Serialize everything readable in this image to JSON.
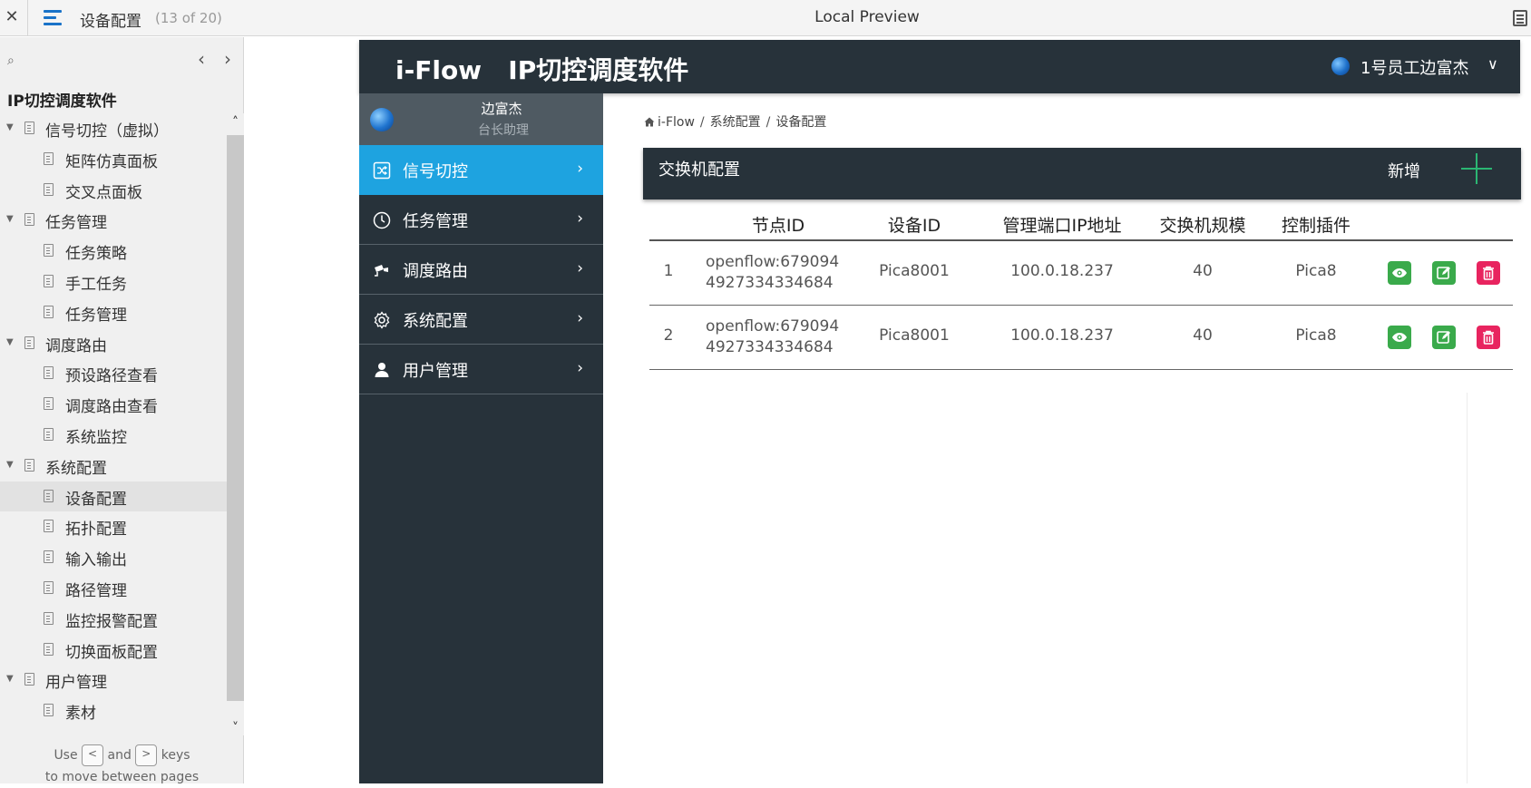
{
  "topbar": {
    "close_glyph": "✕",
    "doc_title": "设备配置",
    "page_counter": "(13 of 20)",
    "preview_title": "Local Preview"
  },
  "toc": {
    "root": "IP切控调度软件",
    "prev_glyph": "‹",
    "next_glyph": "›",
    "items": [
      {
        "label": "信号切控（虚拟）",
        "level": 1
      },
      {
        "label": "矩阵仿真面板",
        "level": 2
      },
      {
        "label": "交叉点面板",
        "level": 2
      },
      {
        "label": "任务管理",
        "level": 1
      },
      {
        "label": "任务策略",
        "level": 2
      },
      {
        "label": "手工任务",
        "level": 2
      },
      {
        "label": "任务管理",
        "level": 2
      },
      {
        "label": "调度路由",
        "level": 1
      },
      {
        "label": "预设路径查看",
        "level": 2
      },
      {
        "label": "调度路由查看",
        "level": 2
      },
      {
        "label": "系统监控",
        "level": 2
      },
      {
        "label": "系统配置",
        "level": 1
      },
      {
        "label": "设备配置",
        "level": 2,
        "active": true
      },
      {
        "label": "拓扑配置",
        "level": 2
      },
      {
        "label": "输入输出",
        "level": 2
      },
      {
        "label": "路径管理",
        "level": 2
      },
      {
        "label": "监控报警配置",
        "level": 2
      },
      {
        "label": "切换面板配置",
        "level": 2
      },
      {
        "label": "用户管理",
        "level": 1
      },
      {
        "label": "素材",
        "level": 2
      }
    ],
    "hint": {
      "use": "Use",
      "key_prev": "<",
      "and": "and",
      "key_next": ">",
      "keys": "keys",
      "line2": "to move between pages"
    }
  },
  "app": {
    "brand": "i-Flow   IP切控调度软件",
    "user_menu": "1号员工边富杰",
    "profile": {
      "name": "边富杰",
      "role": "台长助理"
    },
    "nav": [
      {
        "label": "信号切控",
        "icon": "shuffle-icon",
        "active": true
      },
      {
        "label": "任务管理",
        "icon": "clock-icon"
      },
      {
        "label": "调度路由",
        "icon": "camera-icon"
      },
      {
        "label": "系统配置",
        "icon": "gear-icon"
      },
      {
        "label": "用户管理",
        "icon": "user-icon"
      }
    ],
    "breadcrumb": [
      "i-Flow",
      "系统配置",
      "设备配置"
    ],
    "panel": {
      "title": "交换机配置",
      "add_label": "新增"
    },
    "table": {
      "headers": [
        "节点ID",
        "设备ID",
        "管理端口IP地址",
        "交换机规模",
        "控制插件"
      ],
      "rows": [
        {
          "idx": "1",
          "node_line1": "openflow:679094",
          "node_line2": "4927334334684",
          "device": "Pica8001",
          "ip": "100.0.18.237",
          "scale": "40",
          "plugin": "Pica8"
        },
        {
          "idx": "2",
          "node_line1": "openflow:679094",
          "node_line2": "4927334334684",
          "device": "Pica8001",
          "ip": "100.0.18.237",
          "scale": "40",
          "plugin": "Pica8"
        }
      ]
    }
  },
  "colors": {
    "header_dark": "#27323a",
    "active_blue": "#1ea3e0",
    "action_green": "#3aaa4b",
    "action_red": "#e8245f",
    "add_green": "#2bb673"
  }
}
